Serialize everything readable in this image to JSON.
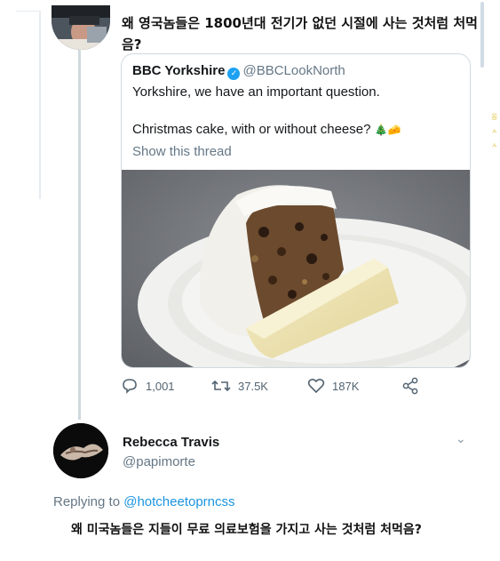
{
  "tweet1": {
    "text": "왜 영국놈들은 1800년대 전기가 없던 시절에 사는 것처럼 처먹음?",
    "embedded": {
      "name": "BBC Yorkshire",
      "verified_icon": "check-badge",
      "handle": "@BBCLookNorth",
      "line1": "Yorkshire, we have an important question.",
      "line2": "Christmas cake, with or without cheese?",
      "emoji_tree": "🎄",
      "emoji_cheese": "🧀",
      "show_thread": "Show this thread",
      "photo_desc": "christmas-cake-with-cheese-photo"
    },
    "actions": {
      "reply_count": "1,001",
      "retweet_count": "37.5K",
      "like_count": "187K"
    }
  },
  "tweet2": {
    "name": "Rebecca Travis",
    "handle": "@papimorte",
    "replying_prefix": "Replying to",
    "replying_to": "@hotcheetoprncss",
    "text": "왜 미국놈들은 지들이 무료 의료보험을 가지고 사는 것처럼 처먹음?"
  },
  "side_glyphs": [
    "옹",
    "ㅅ",
    "ㅅ"
  ],
  "colors": {
    "link": "#1b95e0",
    "secondary": "#657786",
    "verified": "#1da1f2",
    "border": "#cfd9de"
  }
}
